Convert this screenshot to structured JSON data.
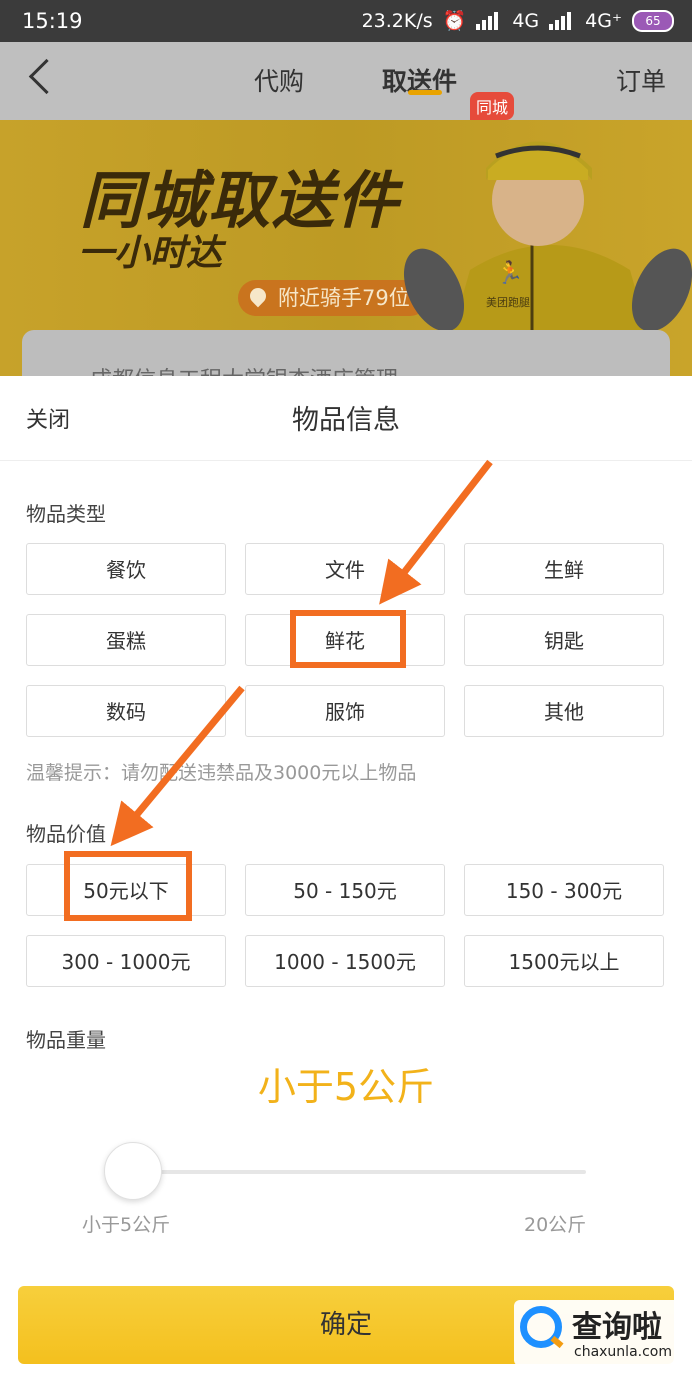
{
  "status_bar": {
    "time": "15:19",
    "net_speed": "23.2K/s",
    "net1": "4G",
    "net2": "4G⁺",
    "battery": "65"
  },
  "nav": {
    "tabs": [
      "代购",
      "取送件",
      "订单"
    ],
    "active_index": 1,
    "badge": "同城"
  },
  "banner": {
    "title": "同城取送件",
    "subtitle": "一小时达",
    "riders": "附近骑手79位",
    "rider_logo": "美团跑腿"
  },
  "card_peek": {
    "text": "成都信息工程大学银杏酒店管理"
  },
  "sheet": {
    "close_label": "关闭",
    "title": "物品信息",
    "type_label": "物品类型",
    "types": [
      "餐饮",
      "文件",
      "生鲜",
      "蛋糕",
      "鲜花",
      "钥匙",
      "数码",
      "服饰",
      "其他"
    ],
    "selected_type": "鲜花",
    "tip": "温馨提示：请勿配送违禁品及3000元以上物品",
    "value_label": "物品价值",
    "values": [
      "50元以下",
      "50 - 150元",
      "150 - 300元",
      "300 - 1000元",
      "1000 - 1500元",
      "1500元以上"
    ],
    "selected_value": "50元以下",
    "weight_label": "物品重量",
    "weight_value": "小于5公斤",
    "weight_min": "小于5公斤",
    "weight_max": "20公斤",
    "confirm": "确定"
  },
  "watermark": {
    "name": "查询啦",
    "url": "chaxunla.com"
  },
  "colors": {
    "accent": "#f4c01e",
    "annotation": "#f26d21",
    "weight_text": "#f2b21a"
  }
}
